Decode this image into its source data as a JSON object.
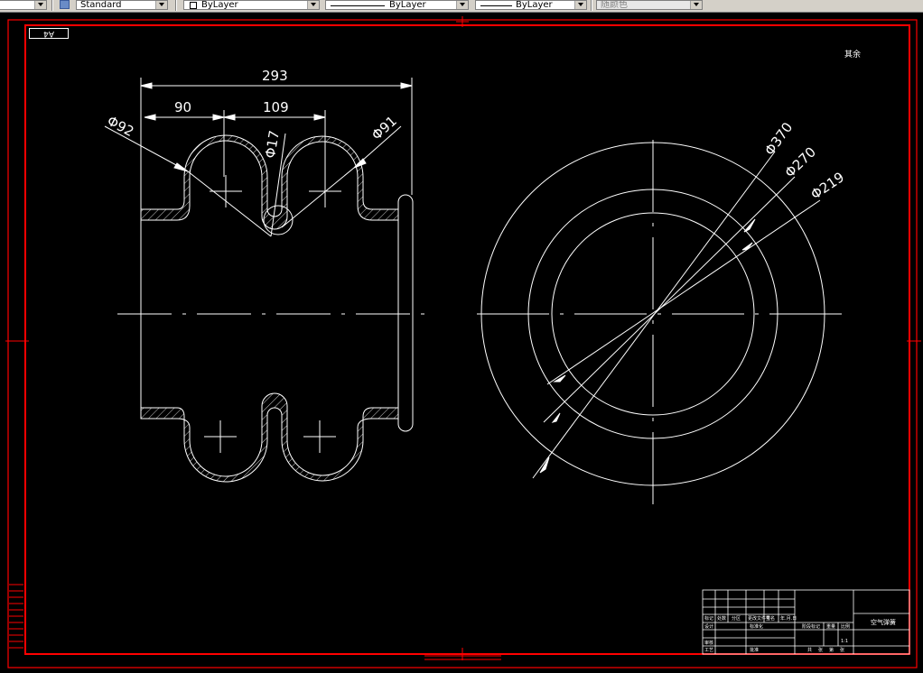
{
  "toolbar": {
    "text_style": "Standard",
    "color": "ByLayer",
    "linetype": "ByLayer",
    "lineweight": "ByLayer",
    "plot_style": "随颜色"
  },
  "drawing": {
    "sheet_label": "A4",
    "note": "其余",
    "dims": {
      "overall_length": "293",
      "left_pitch": "90",
      "right_pitch": "109",
      "left_bulge": "Φ92",
      "right_bulge": "Φ91",
      "root_dia": "Φ17",
      "outer_dia": "Φ370",
      "mid_dia": "Φ270",
      "inner_dia": "Φ219"
    },
    "title_block": {
      "name": "空气弹簧",
      "cells": [
        "标记",
        "处数",
        "分区",
        "更改文件号",
        "签名",
        "年.月.日",
        "设计",
        "标准化",
        "阶段标记",
        "重量",
        "比例",
        "审核",
        "工艺",
        "批准",
        "共",
        "张",
        "第",
        "张",
        "1:1"
      ]
    }
  },
  "colors": {
    "frame": "#ff0000",
    "lines": "#ffffff",
    "background": "#000000",
    "toolbar": "#d4d0c8"
  }
}
